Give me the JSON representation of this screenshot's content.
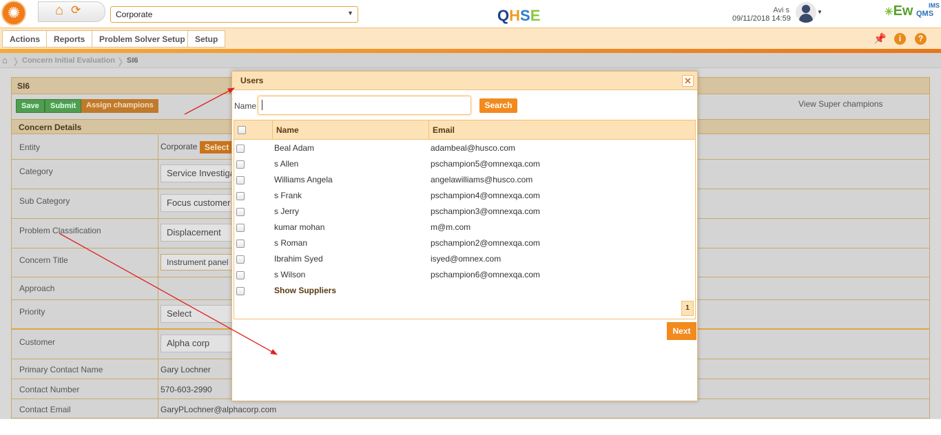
{
  "header": {
    "entity_select": "Corporate",
    "app_logo": "QHSE",
    "user_name": "Avi s",
    "datetime": "09/11/2018 14:59",
    "brand": "Ew",
    "brand_sup": "IMS",
    "brand_sub": "QMS"
  },
  "menu": {
    "items": [
      "Actions",
      "Reports",
      "Problem Solver Setup",
      "Setup"
    ]
  },
  "breadcrumb": {
    "items": [
      "Concern Initial Evaluation",
      "SI6"
    ]
  },
  "page": {
    "section_title": "SI6",
    "buttons": {
      "save": "Save",
      "submit": "Submit",
      "assign": "Assign champions"
    },
    "view_super": "View Super champions",
    "details_title": "Concern Details",
    "fields": [
      {
        "label": "Entity",
        "value": "Corporate",
        "action": "Select"
      },
      {
        "label": "Category",
        "value": "Service Investiga"
      },
      {
        "label": "Sub Category",
        "value": "Focus customer"
      },
      {
        "label": "Problem Classification",
        "value": "Displacement"
      },
      {
        "label": "Concern Title",
        "value": "Instrument panel"
      },
      {
        "label": "Approach",
        "value": ""
      },
      {
        "label": "Priority",
        "value": "Select"
      },
      {
        "label": "Customer",
        "value": "Alpha corp"
      },
      {
        "label": "Primary Contact Name",
        "value": "Gary Lochner"
      },
      {
        "label": "Contact Number",
        "value": "570-603-2990"
      },
      {
        "label": "Contact Email",
        "value": "GaryPLochner@alphacorp.com"
      }
    ]
  },
  "modal": {
    "title": "Users",
    "name_label": "Name",
    "name_value": "",
    "search_label": "Search",
    "columns": [
      "Name",
      "Email"
    ],
    "rows": [
      {
        "name": "Beal Adam",
        "email": "adambeal@husco.com"
      },
      {
        "name": "s Allen",
        "email": "pschampion5@omnexqa.com"
      },
      {
        "name": "Williams Angela",
        "email": "angelawilliams@husco.com"
      },
      {
        "name": "s Frank",
        "email": "pschampion4@omnexqa.com"
      },
      {
        "name": "s Jerry",
        "email": "pschampion3@omnexqa.com"
      },
      {
        "name": "kumar mohan",
        "email": "m@m.com"
      },
      {
        "name": "s Roman",
        "email": "pschampion2@omnexqa.com"
      },
      {
        "name": "Ibrahim Syed",
        "email": "isyed@omnex.com"
      },
      {
        "name": "s Wilson",
        "email": "pschampion6@omnexqa.com"
      }
    ],
    "show_suppliers": "Show Suppliers",
    "page": "1",
    "next_label": "Next"
  },
  "colors": {
    "accent": "#f28a1e",
    "header_bg": "#fde2b8",
    "annotation_arrow": "#e02020"
  }
}
